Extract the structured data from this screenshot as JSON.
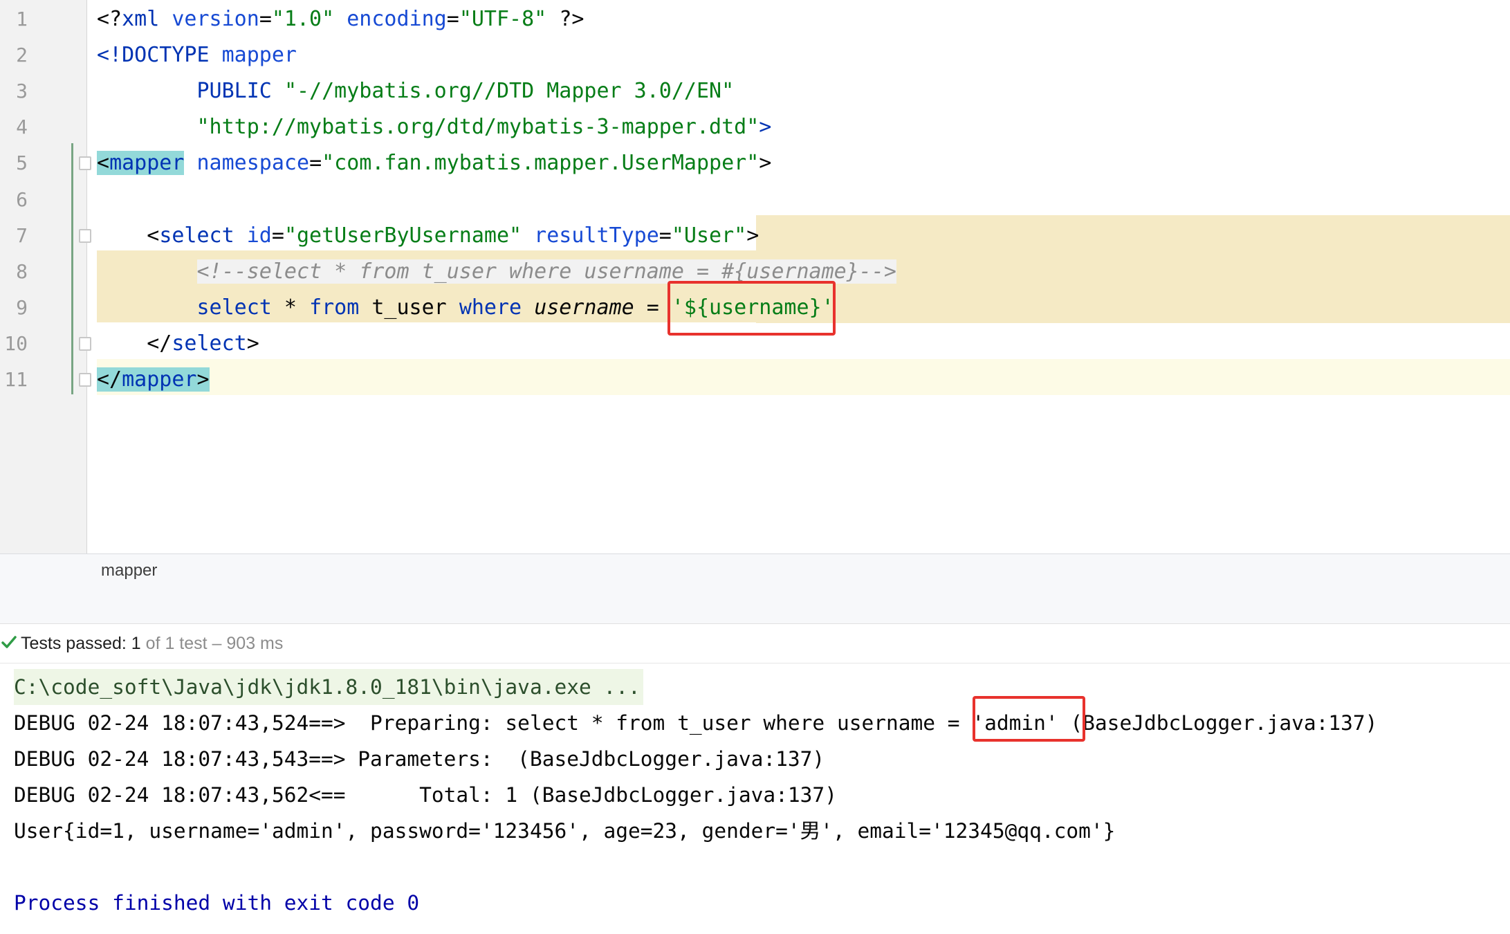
{
  "editor": {
    "lines": [
      {
        "num": "1",
        "segments": [
          {
            "text": "<?",
            "cls": "t-plain"
          },
          {
            "text": "xml ",
            "cls": "t-tag"
          },
          {
            "text": "version",
            "cls": "t-attr"
          },
          {
            "text": "=",
            "cls": "t-plain"
          },
          {
            "text": "\"1.0\" ",
            "cls": "t-str"
          },
          {
            "text": "encoding",
            "cls": "t-attr"
          },
          {
            "text": "=",
            "cls": "t-plain"
          },
          {
            "text": "\"UTF-8\" ",
            "cls": "t-str"
          },
          {
            "text": "?>",
            "cls": "t-plain"
          }
        ]
      },
      {
        "num": "2",
        "segments": [
          {
            "text": "<!DOCTYPE ",
            "cls": "t-tag"
          },
          {
            "text": "mapper",
            "cls": "t-attr"
          }
        ]
      },
      {
        "num": "3",
        "segments": [
          {
            "text": "        PUBLIC ",
            "cls": "t-tag"
          },
          {
            "text": "\"-//mybatis.org//DTD Mapper 3.0//EN\"",
            "cls": "t-str"
          }
        ]
      },
      {
        "num": "4",
        "segments": [
          {
            "text": "        \"http://mybatis.org/dtd/mybatis-3-mapper.dtd\"",
            "cls": "t-str"
          },
          {
            "text": ">",
            "cls": "t-tag"
          }
        ]
      },
      {
        "num": "5",
        "fold": true,
        "segments": [
          {
            "text": "<",
            "cls": "t-plain hl-tag"
          },
          {
            "text": "mapper",
            "cls": "t-tag hl-tag"
          },
          {
            "text": " ",
            "cls": "t-plain"
          },
          {
            "text": "namespace",
            "cls": "t-attr"
          },
          {
            "text": "=",
            "cls": "t-plain"
          },
          {
            "text": "\"com.fan.mybatis.mapper.UserMapper\"",
            "cls": "t-str"
          },
          {
            "text": ">",
            "cls": "t-plain"
          }
        ]
      },
      {
        "num": "6",
        "segments": []
      },
      {
        "num": "7",
        "fold": true,
        "segments": [
          {
            "text": "    <",
            "cls": "t-plain"
          },
          {
            "text": "select ",
            "cls": "t-tag"
          },
          {
            "text": "id",
            "cls": "t-attr"
          },
          {
            "text": "=",
            "cls": "t-plain"
          },
          {
            "text": "\"getUserByUsername\" ",
            "cls": "t-str"
          },
          {
            "text": "resultType",
            "cls": "t-attr"
          },
          {
            "text": "=",
            "cls": "t-plain"
          },
          {
            "text": "\"User\"",
            "cls": "t-str"
          },
          {
            "text": ">",
            "cls": "t-plain"
          }
        ]
      },
      {
        "num": "8",
        "segments": [
          {
            "text": "        ",
            "cls": "t-plain"
          },
          {
            "text": "<!--select * from t_user where username = #{username}-->",
            "cls": "t-cm cm-bg"
          }
        ]
      },
      {
        "num": "9",
        "segments": [
          {
            "text": "        ",
            "cls": "t-plain"
          },
          {
            "text": "select",
            "cls": "t-kw"
          },
          {
            "text": " * ",
            "cls": "t-plain"
          },
          {
            "text": "from",
            "cls": "t-kw"
          },
          {
            "text": " t_user ",
            "cls": "t-plain"
          },
          {
            "text": "where",
            "cls": "t-kw"
          },
          {
            "text": " ",
            "cls": "t-plain"
          },
          {
            "text": "username",
            "cls": "t-it"
          },
          {
            "text": " = ",
            "cls": "t-plain"
          },
          {
            "text": "'${username}'",
            "cls": "t-str"
          }
        ]
      },
      {
        "num": "10",
        "fold": true,
        "segments": [
          {
            "text": "    </",
            "cls": "t-plain"
          },
          {
            "text": "select",
            "cls": "t-tag"
          },
          {
            "text": ">",
            "cls": "t-plain"
          }
        ]
      },
      {
        "num": "11",
        "fold": true,
        "segments": [
          {
            "text": "</",
            "cls": "t-plain hl-tag"
          },
          {
            "text": "mapper",
            "cls": "t-tag hl-tag"
          },
          {
            "text": ">",
            "cls": "t-plain hl-tag"
          }
        ]
      }
    ]
  },
  "breadcrumb": {
    "label": "mapper"
  },
  "test_status": {
    "prefix": "Tests passed: 1",
    "suffix": " of 1 test – 903 ms",
    "icon": "check-icon",
    "color": "#2f9c46"
  },
  "console": {
    "cmd": "C:\\code_soft\\Java\\jdk\\jdk1.8.0_181\\bin\\java.exe ...",
    "line1": "DEBUG 02-24 18:07:43,524==>  Preparing: select * from t_user where username = 'admin' (BaseJdbcLogger.java:137)",
    "line2": "DEBUG 02-24 18:07:43,543==> Parameters:  (BaseJdbcLogger.java:137)",
    "line3": "DEBUG 02-24 18:07:43,562<==      Total: 1 (BaseJdbcLogger.java:137)",
    "line4": "User{id=1, username='admin', password='123456', age=23, gender='男', email='12345@qq.com'}",
    "line5": "Process finished with exit code 0"
  },
  "colors": {
    "highlight_box": "#e8322d",
    "selection_band": "#f5eac5"
  }
}
